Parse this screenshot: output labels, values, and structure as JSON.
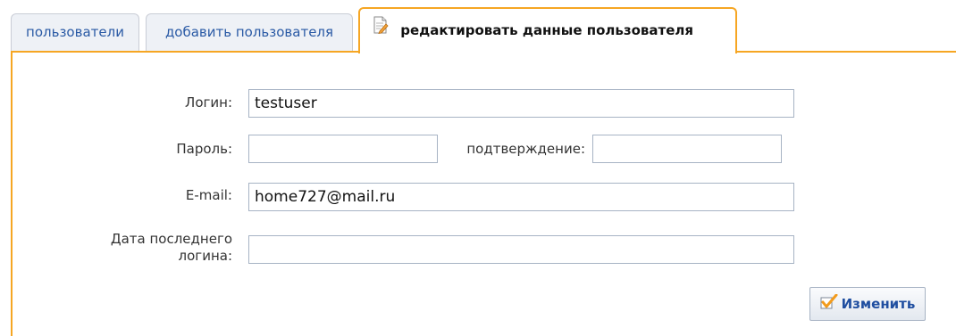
{
  "tabs": {
    "users": "пользователи",
    "add_user": "добавить пользователя",
    "edit_user": "редактировать данные пользователя"
  },
  "form": {
    "login_label": "Логин:",
    "login_value": "testuser",
    "password_label": "Пароль:",
    "password_value": "",
    "confirm_label": "подтверждение:",
    "confirm_value": "",
    "email_label": "E-mail:",
    "email_value": "home727@mail.ru",
    "last_login_label_line1": "Дата последнего",
    "last_login_label_line2": "логина:",
    "last_login_value": ""
  },
  "submit_label": "Изменить",
  "colors": {
    "accent_border": "#f6a623",
    "tab_link": "#2a5aa5",
    "button_text": "#1f4ea0",
    "check": "#f29b1d"
  },
  "icons": {
    "edit_tab": "document-edit-icon",
    "submit": "checkmark-icon"
  }
}
